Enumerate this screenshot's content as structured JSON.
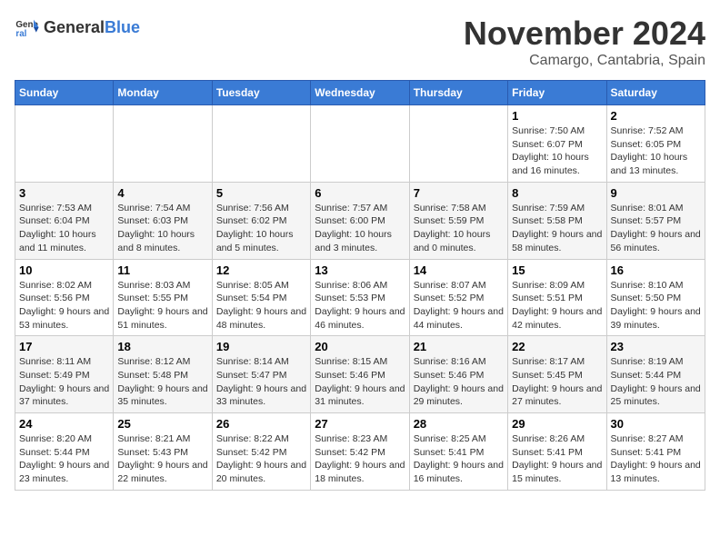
{
  "logo": {
    "text_general": "General",
    "text_blue": "Blue"
  },
  "title": "November 2024",
  "location": "Camargo, Cantabria, Spain",
  "weekdays": [
    "Sunday",
    "Monday",
    "Tuesday",
    "Wednesday",
    "Thursday",
    "Friday",
    "Saturday"
  ],
  "weeks": [
    [
      {
        "day": "",
        "info": ""
      },
      {
        "day": "",
        "info": ""
      },
      {
        "day": "",
        "info": ""
      },
      {
        "day": "",
        "info": ""
      },
      {
        "day": "",
        "info": ""
      },
      {
        "day": "1",
        "info": "Sunrise: 7:50 AM\nSunset: 6:07 PM\nDaylight: 10 hours and 16 minutes."
      },
      {
        "day": "2",
        "info": "Sunrise: 7:52 AM\nSunset: 6:05 PM\nDaylight: 10 hours and 13 minutes."
      }
    ],
    [
      {
        "day": "3",
        "info": "Sunrise: 7:53 AM\nSunset: 6:04 PM\nDaylight: 10 hours and 11 minutes."
      },
      {
        "day": "4",
        "info": "Sunrise: 7:54 AM\nSunset: 6:03 PM\nDaylight: 10 hours and 8 minutes."
      },
      {
        "day": "5",
        "info": "Sunrise: 7:56 AM\nSunset: 6:02 PM\nDaylight: 10 hours and 5 minutes."
      },
      {
        "day": "6",
        "info": "Sunrise: 7:57 AM\nSunset: 6:00 PM\nDaylight: 10 hours and 3 minutes."
      },
      {
        "day": "7",
        "info": "Sunrise: 7:58 AM\nSunset: 5:59 PM\nDaylight: 10 hours and 0 minutes."
      },
      {
        "day": "8",
        "info": "Sunrise: 7:59 AM\nSunset: 5:58 PM\nDaylight: 9 hours and 58 minutes."
      },
      {
        "day": "9",
        "info": "Sunrise: 8:01 AM\nSunset: 5:57 PM\nDaylight: 9 hours and 56 minutes."
      }
    ],
    [
      {
        "day": "10",
        "info": "Sunrise: 8:02 AM\nSunset: 5:56 PM\nDaylight: 9 hours and 53 minutes."
      },
      {
        "day": "11",
        "info": "Sunrise: 8:03 AM\nSunset: 5:55 PM\nDaylight: 9 hours and 51 minutes."
      },
      {
        "day": "12",
        "info": "Sunrise: 8:05 AM\nSunset: 5:54 PM\nDaylight: 9 hours and 48 minutes."
      },
      {
        "day": "13",
        "info": "Sunrise: 8:06 AM\nSunset: 5:53 PM\nDaylight: 9 hours and 46 minutes."
      },
      {
        "day": "14",
        "info": "Sunrise: 8:07 AM\nSunset: 5:52 PM\nDaylight: 9 hours and 44 minutes."
      },
      {
        "day": "15",
        "info": "Sunrise: 8:09 AM\nSunset: 5:51 PM\nDaylight: 9 hours and 42 minutes."
      },
      {
        "day": "16",
        "info": "Sunrise: 8:10 AM\nSunset: 5:50 PM\nDaylight: 9 hours and 39 minutes."
      }
    ],
    [
      {
        "day": "17",
        "info": "Sunrise: 8:11 AM\nSunset: 5:49 PM\nDaylight: 9 hours and 37 minutes."
      },
      {
        "day": "18",
        "info": "Sunrise: 8:12 AM\nSunset: 5:48 PM\nDaylight: 9 hours and 35 minutes."
      },
      {
        "day": "19",
        "info": "Sunrise: 8:14 AM\nSunset: 5:47 PM\nDaylight: 9 hours and 33 minutes."
      },
      {
        "day": "20",
        "info": "Sunrise: 8:15 AM\nSunset: 5:46 PM\nDaylight: 9 hours and 31 minutes."
      },
      {
        "day": "21",
        "info": "Sunrise: 8:16 AM\nSunset: 5:46 PM\nDaylight: 9 hours and 29 minutes."
      },
      {
        "day": "22",
        "info": "Sunrise: 8:17 AM\nSunset: 5:45 PM\nDaylight: 9 hours and 27 minutes."
      },
      {
        "day": "23",
        "info": "Sunrise: 8:19 AM\nSunset: 5:44 PM\nDaylight: 9 hours and 25 minutes."
      }
    ],
    [
      {
        "day": "24",
        "info": "Sunrise: 8:20 AM\nSunset: 5:44 PM\nDaylight: 9 hours and 23 minutes."
      },
      {
        "day": "25",
        "info": "Sunrise: 8:21 AM\nSunset: 5:43 PM\nDaylight: 9 hours and 22 minutes."
      },
      {
        "day": "26",
        "info": "Sunrise: 8:22 AM\nSunset: 5:42 PM\nDaylight: 9 hours and 20 minutes."
      },
      {
        "day": "27",
        "info": "Sunrise: 8:23 AM\nSunset: 5:42 PM\nDaylight: 9 hours and 18 minutes."
      },
      {
        "day": "28",
        "info": "Sunrise: 8:25 AM\nSunset: 5:41 PM\nDaylight: 9 hours and 16 minutes."
      },
      {
        "day": "29",
        "info": "Sunrise: 8:26 AM\nSunset: 5:41 PM\nDaylight: 9 hours and 15 minutes."
      },
      {
        "day": "30",
        "info": "Sunrise: 8:27 AM\nSunset: 5:41 PM\nDaylight: 9 hours and 13 minutes."
      }
    ]
  ]
}
